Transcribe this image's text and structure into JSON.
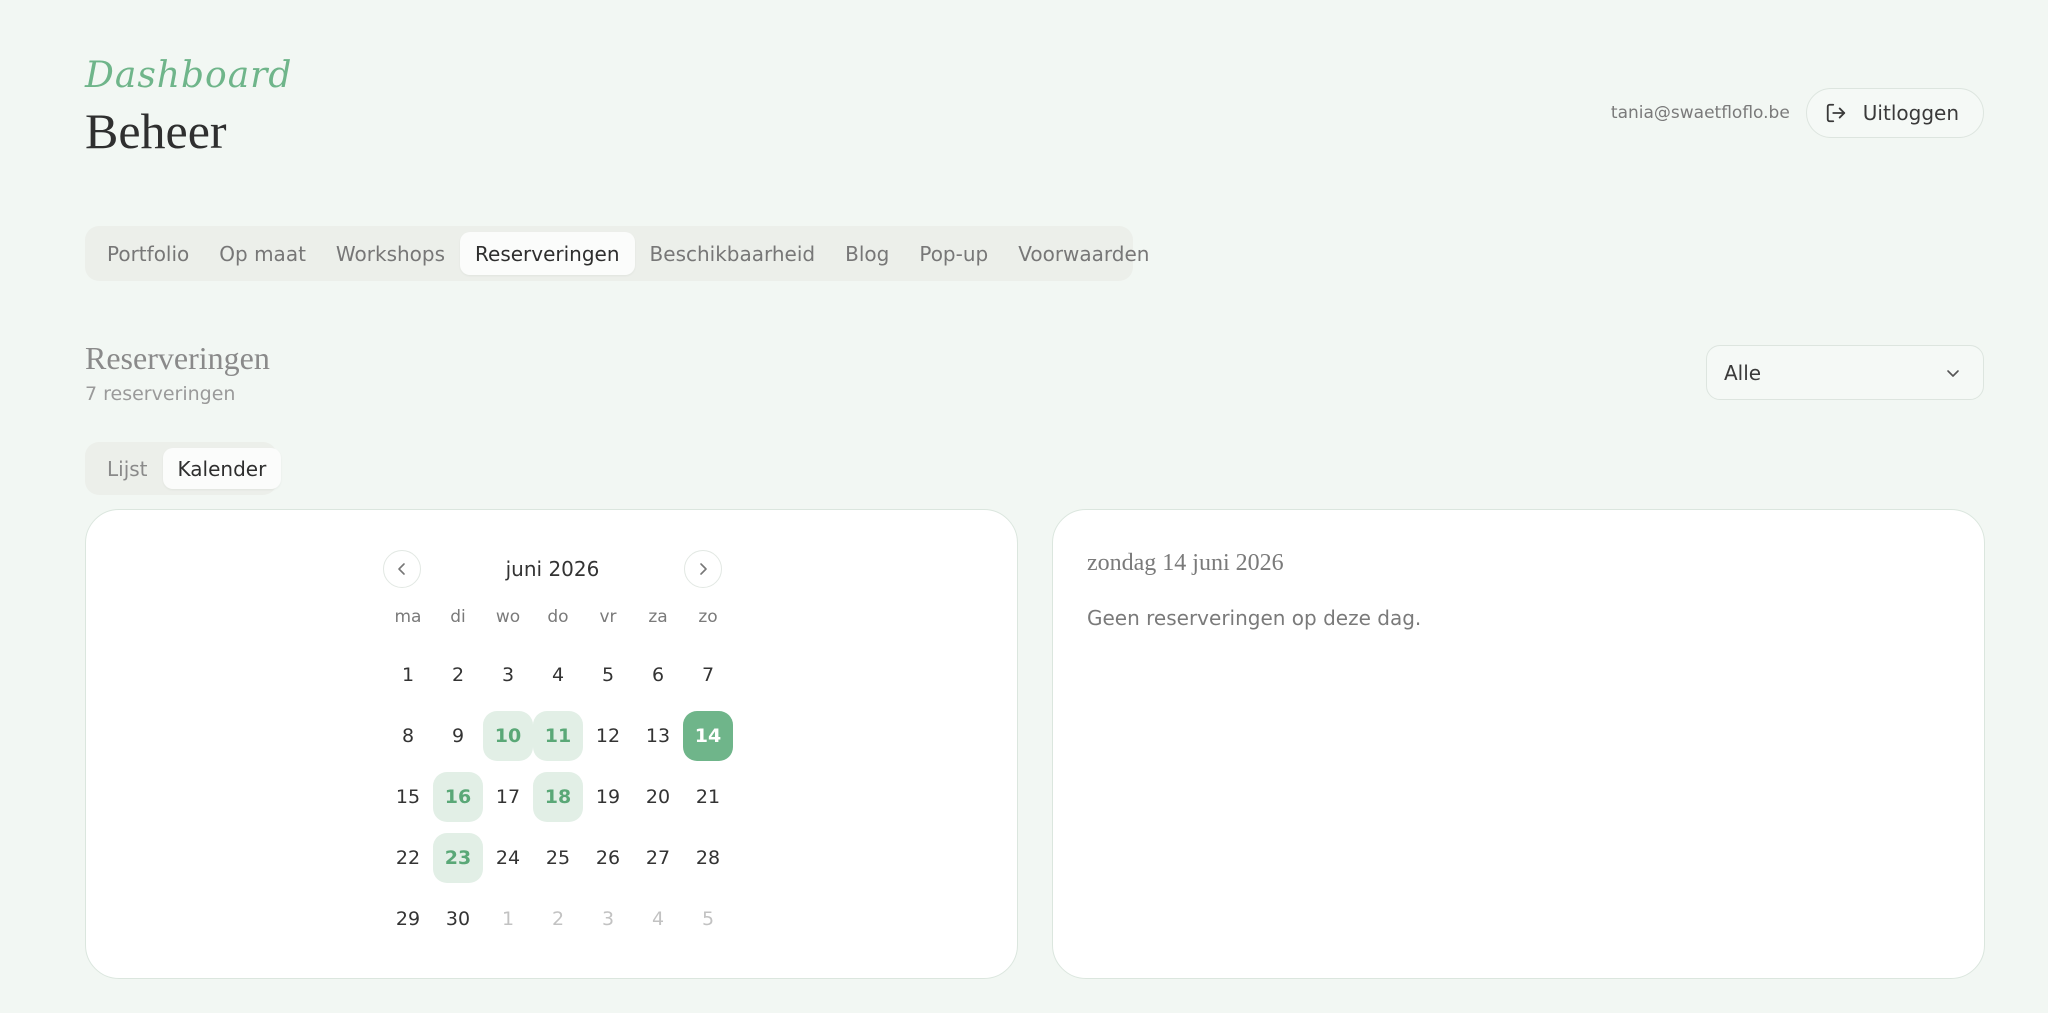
{
  "header": {
    "brand_script": "Dashboard",
    "brand_title": "Beheer",
    "user_email": "tania@swaetfloflo.be",
    "logout_label": "Uitloggen"
  },
  "tabs": [
    {
      "label": "Portfolio",
      "active": false
    },
    {
      "label": "Op maat",
      "active": false
    },
    {
      "label": "Workshops",
      "active": false
    },
    {
      "label": "Reserveringen",
      "active": true
    },
    {
      "label": "Beschikbaarheid",
      "active": false
    },
    {
      "label": "Blog",
      "active": false
    },
    {
      "label": "Pop-up",
      "active": false
    },
    {
      "label": "Voorwaarden",
      "active": false
    }
  ],
  "section": {
    "title": "Reserveringen",
    "subtitle": "7 reserveringen",
    "filter_value": "Alle"
  },
  "view_toggle": {
    "list_label": "Lijst",
    "calendar_label": "Kalender",
    "active": "Kalender"
  },
  "calendar": {
    "month_label": "juni 2026",
    "weekdays": [
      "ma",
      "di",
      "wo",
      "do",
      "vr",
      "za",
      "zo"
    ],
    "days": [
      {
        "label": "1",
        "state": "normal"
      },
      {
        "label": "2",
        "state": "normal"
      },
      {
        "label": "3",
        "state": "normal"
      },
      {
        "label": "4",
        "state": "normal"
      },
      {
        "label": "5",
        "state": "normal"
      },
      {
        "label": "6",
        "state": "normal"
      },
      {
        "label": "7",
        "state": "normal"
      },
      {
        "label": "8",
        "state": "normal"
      },
      {
        "label": "9",
        "state": "normal"
      },
      {
        "label": "10",
        "state": "booked"
      },
      {
        "label": "11",
        "state": "booked"
      },
      {
        "label": "12",
        "state": "normal"
      },
      {
        "label": "13",
        "state": "normal"
      },
      {
        "label": "14",
        "state": "selected"
      },
      {
        "label": "15",
        "state": "normal"
      },
      {
        "label": "16",
        "state": "booked"
      },
      {
        "label": "17",
        "state": "normal"
      },
      {
        "label": "18",
        "state": "booked"
      },
      {
        "label": "19",
        "state": "normal"
      },
      {
        "label": "20",
        "state": "normal"
      },
      {
        "label": "21",
        "state": "normal"
      },
      {
        "label": "22",
        "state": "normal"
      },
      {
        "label": "23",
        "state": "booked"
      },
      {
        "label": "24",
        "state": "normal"
      },
      {
        "label": "25",
        "state": "normal"
      },
      {
        "label": "26",
        "state": "normal"
      },
      {
        "label": "27",
        "state": "normal"
      },
      {
        "label": "28",
        "state": "normal"
      },
      {
        "label": "29",
        "state": "normal"
      },
      {
        "label": "30",
        "state": "normal"
      },
      {
        "label": "1",
        "state": "outside"
      },
      {
        "label": "2",
        "state": "outside"
      },
      {
        "label": "3",
        "state": "outside"
      },
      {
        "label": "4",
        "state": "outside"
      },
      {
        "label": "5",
        "state": "outside"
      }
    ]
  },
  "day_detail": {
    "title": "zondag 14 juni 2026",
    "empty_message": "Geen reserveringen op deze dag."
  },
  "colors": {
    "accent": "#6fb58a",
    "booked_bg": "#e2efe6",
    "page_bg": "#f2f7f3"
  },
  "icons": {
    "logout": "logout-icon",
    "dropdown": "chevron-down-icon",
    "prev": "chevron-left-icon",
    "next": "chevron-right-icon"
  }
}
